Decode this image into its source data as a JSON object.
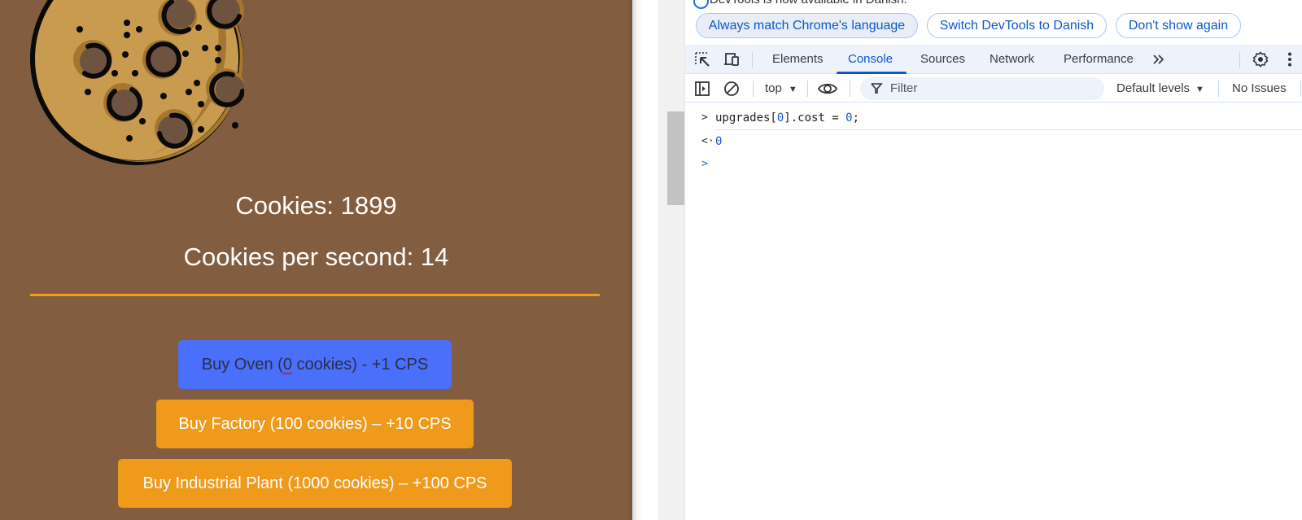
{
  "game": {
    "cookies_label": "Cookies: 1899",
    "cps_label": "Cookies per second: 14",
    "cookie_icon": "cookie-icon",
    "colors": {
      "background": "#835d3f",
      "divider": "#f39c1c",
      "oven_button": "#4a6ffb",
      "upgrade_button": "#f09a1c"
    },
    "buttons": [
      {
        "id": "oven",
        "prefix": "Buy Oven (",
        "cost": "0",
        "suffix": " cookies) - +1 CPS",
        "spellcheck_flag": true
      },
      {
        "id": "factory",
        "label": "Buy Factory (100 cookies) – +10 CPS"
      },
      {
        "id": "plant",
        "label": "Buy Industrial Plant (1000 cookies) – +100 CPS"
      }
    ]
  },
  "devtools": {
    "infobar": {
      "icon": "info-icon",
      "message": "DevTools is now available in Danish.",
      "buttons": [
        "Always match Chrome's language",
        "Switch DevTools to Danish",
        "Don't show again"
      ]
    },
    "toolbar_icons": [
      "inspect-element-icon",
      "device-toolbar-icon"
    ],
    "tabs": [
      {
        "label": "Elements",
        "active": false
      },
      {
        "label": "Console",
        "active": true
      },
      {
        "label": "Sources",
        "active": false
      },
      {
        "label": "Network",
        "active": false
      },
      {
        "label": "Performance",
        "active": false
      }
    ],
    "more_tabs_icon": "chevron-double-right-icon",
    "settings_icon": "gear-icon",
    "menu_icon": "kebab-menu-icon",
    "console_toolbar": {
      "sidebar_icon": "sidebar-toggle-icon",
      "clear_icon": "clear-console-icon",
      "context": "top",
      "live_expression_icon": "eye-icon",
      "filter_icon": "funnel-icon",
      "filter_placeholder": "Filter",
      "levels": "Default levels",
      "issues": "No Issues"
    },
    "console": {
      "input": {
        "prompt": ">",
        "code_before": "upgrades[",
        "code_index": "0",
        "code_mid": "].cost = ",
        "code_value": "0",
        "code_after": ";"
      },
      "result": {
        "prompt": "<·",
        "value": "0"
      },
      "next_prompt": ">"
    },
    "accent": "#0b57d0"
  }
}
